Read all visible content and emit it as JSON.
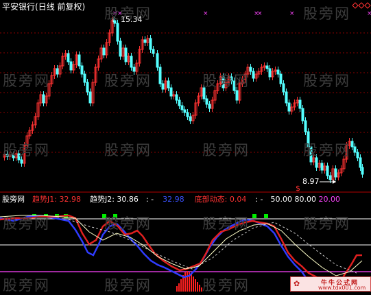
{
  "title_bar": {
    "stock": "平安银行",
    "period": "(日线 前复权)"
  },
  "watermark": "股旁网",
  "price_panel": {
    "high_label": "15.34",
    "low_label": "8.97",
    "low_marker": "$",
    "colors": {
      "up": "#ff3232",
      "down": "#54ffff",
      "grid": "#8c0000",
      "marker": "#ff44ff"
    }
  },
  "indicator_header": {
    "site": "股旁网",
    "j1_label": "趋势J1:",
    "j1_value": "32.98",
    "j2_label": "趋势J2:",
    "j2_value": "30.86",
    "j2_suffix": ":",
    "dash": "-",
    "blue_value": "32.98",
    "bottom_label": "底部动态:",
    "bottom_value": "0.04",
    "c1": ":",
    "c2": "-",
    "lvl50": "50.00",
    "lvl80": "80.00",
    "lvl20": "20.00"
  },
  "stamp": {
    "line1": "牛牛公式网",
    "line2": "www.tdx001.com"
  }
}
